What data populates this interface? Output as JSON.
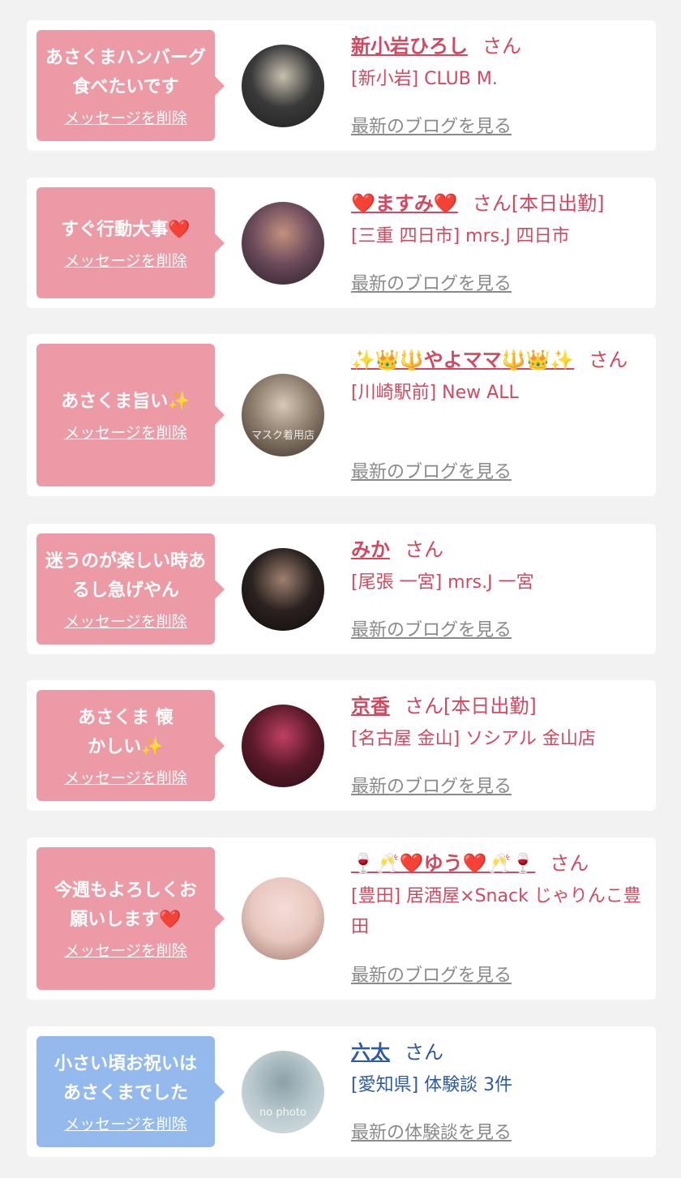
{
  "items": [
    {
      "message": "あさくまハンバーグ食べたいです",
      "delete_label": "メッセージを削除",
      "name": "新小岩ひろし",
      "suffix": "さん",
      "shop": "[新小岩] CLUB M.",
      "link": "最新のブログを見る",
      "theme": "pink",
      "avatar_colors": [
        "#3a3a3a",
        "#c8c0b0",
        "#1e1e1e"
      ]
    },
    {
      "message": "すぐ行動大事❤️",
      "delete_label": "メッセージを削除",
      "name": "❤️ますみ❤️",
      "suffix": "さん[本日出勤]",
      "shop": "[三重 四日市] mrs.J 四日市",
      "link": "最新のブログを見る",
      "theme": "pink",
      "avatar_colors": [
        "#6a4a5a",
        "#c49080",
        "#2a1e28"
      ]
    },
    {
      "message": "あさくま旨い✨",
      "delete_label": "メッセージを削除",
      "name": "✨👑🔱やよママ🔱👑✨",
      "suffix": "さん",
      "shop": "[川崎駅前] New ALL",
      "link": "最新のブログを見る",
      "theme": "pink",
      "avatar_colors": [
        "#8a7a6a",
        "#d8c8b8",
        "#3a3028"
      ],
      "avatar_caption": "マスク着用店"
    },
    {
      "message": "迷うのが楽しい時あるし急げやん",
      "delete_label": "メッセージを削除",
      "name": "みか",
      "suffix": "さん",
      "shop": "[尾張 一宮] mrs.J 一宮",
      "link": "最新のブログを見る",
      "theme": "pink",
      "avatar_colors": [
        "#2a2220",
        "#a08070",
        "#0e0a0a"
      ]
    },
    {
      "message": "あさくま 懐かしい✨",
      "delete_label": "メッセージを削除",
      "name": "京香",
      "suffix": "さん[本日出勤]",
      "shop": "[名古屋 金山] ソシアル 金山店",
      "link": "最新のブログを見る",
      "theme": "pink",
      "avatar_colors": [
        "#5a1a2a",
        "#c04060",
        "#2a0a14"
      ]
    },
    {
      "message": "今週もよろしくお願いします❤️",
      "delete_label": "メッセージを削除",
      "name": "🍷🥂❤️ゆう❤️🥂🍷",
      "suffix": "さん",
      "shop": "[豊田] 居酒屋×Snack じゃりんこ豊田",
      "link": "最新のブログを見る",
      "theme": "pink",
      "avatar_colors": [
        "#e8c8c0",
        "#f4dcd8",
        "#a07868"
      ]
    },
    {
      "message": "小さい頃お祝いはあさくまでした",
      "delete_label": "メッセージを削除",
      "name": "六太",
      "suffix": "さん",
      "shop": "[愛知県] 体験談 3件",
      "link": "最新の体験談を見る",
      "theme": "blue",
      "avatar_colors": [
        "#b8c8cc",
        "#8aa0a8",
        "#d8e2e4"
      ],
      "avatar_caption": "no photo"
    }
  ]
}
